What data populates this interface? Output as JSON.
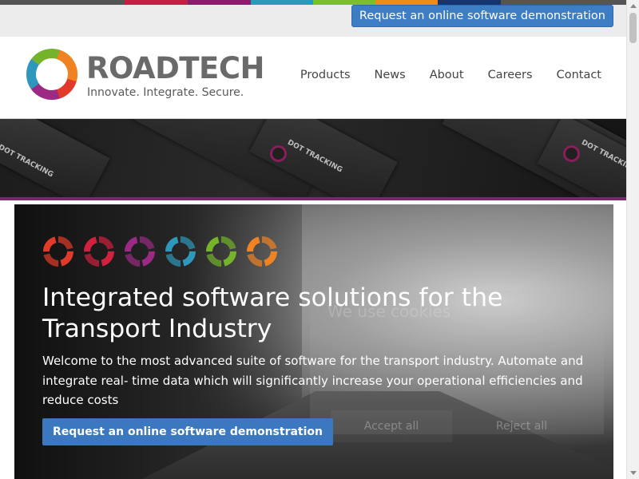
{
  "top_color_bar": [
    "#555555",
    "#555555",
    "#c81e44",
    "#8a1d6e",
    "#2a9bb8",
    "#7dbf2b",
    "#f08a1e",
    "#16356e",
    "#555555"
  ],
  "top_bar": {
    "demo_button_label": "Request an online software demonstration"
  },
  "header": {
    "brand_name": "ROADTECH",
    "tagline": "Innovate. Integrate. Secure.",
    "nav": [
      "Products",
      "News",
      "About",
      "Careers",
      "Contact"
    ]
  },
  "product_strip": {
    "badges": [
      "DOT TRACKING",
      "DOT TRACKING",
      "DOT TRACKING"
    ],
    "accent_color": "#7a2a6a"
  },
  "hero": {
    "ring_colors": [
      "#e23a2a",
      "#d2213f",
      "#9c2a85",
      "#2e98bc",
      "#74b32a",
      "#ef8322"
    ],
    "title": "Integrated software solutions for the Transport Industry",
    "description": "Welcome to the most advanced suite of software for the transport industry. Automate and integrate real- time data which will significantly increase your operational efficiencies and reduce costs",
    "cta_label": "Request an online software demonstration"
  },
  "cookie_overlay": {
    "title": "We use cookies",
    "accept_label": "Accept all",
    "reject_label": "Reject all"
  },
  "colors": {
    "button_blue": "#3b78c0",
    "header_bg": "#ffffff",
    "top_strip_bg": "#ececec"
  }
}
